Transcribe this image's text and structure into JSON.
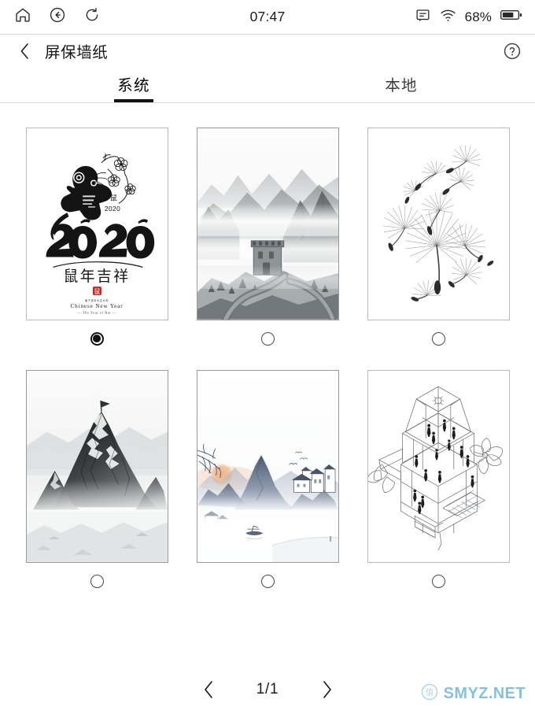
{
  "statusbar": {
    "time": "07:47",
    "battery_percent": "68%",
    "icons": {
      "home": "home-icon",
      "back": "back-circle-icon",
      "refresh": "refresh-icon",
      "note": "note-icon",
      "wifi": "wifi-icon",
      "battery": "battery-icon"
    },
    "battery_level": 0.62
  },
  "header": {
    "back_label": "back-chevron",
    "title": "屏保墙纸",
    "help_label": "?"
  },
  "tabs": [
    {
      "label": "系统",
      "active": true
    },
    {
      "label": "本地",
      "active": false
    }
  ],
  "wallpapers": [
    {
      "name": "wallpaper-year-of-rat-2020",
      "caption": "2020 鼠年吉祥",
      "selected": true,
      "art": "rat2020",
      "texts": {
        "year": "2020",
        "phrase": "鼠年吉祥",
        "en1": "Chinese New Year",
        "en2": "The Year of Rat",
        "small": "2020",
        "seal": "鼠"
      }
    },
    {
      "name": "wallpaper-great-wall-mist",
      "caption": "长城云海",
      "selected": false,
      "art": "greatwall"
    },
    {
      "name": "wallpaper-dandelion-seeds",
      "caption": "蒲公英",
      "selected": false,
      "art": "dandelion"
    },
    {
      "name": "wallpaper-snow-peak",
      "caption": "雪山",
      "selected": false,
      "art": "snowpeak"
    },
    {
      "name": "wallpaper-ink-landscape-sunrise",
      "caption": "水墨山水",
      "selected": false,
      "art": "inkscape"
    },
    {
      "name": "wallpaper-isometric-house",
      "caption": "线稿房屋",
      "selected": false,
      "art": "isohouse"
    }
  ],
  "pager": {
    "prev": "‹",
    "next": "›",
    "label": "1/1",
    "current_page": 1,
    "total_pages": 1
  },
  "watermark": {
    "text": "SMYZ.NET",
    "logo_char": "值",
    "color": "#7cbcd8"
  },
  "colors": {
    "accent": "#111111",
    "text": "#1a1a1a",
    "divider": "#dcdcdc",
    "card_border": "#b9b9b9",
    "watermark": "#7cbcd8"
  }
}
